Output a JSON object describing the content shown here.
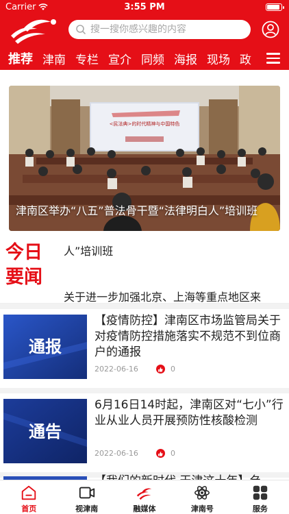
{
  "status_bar": {
    "carrier": "Carrier",
    "time": "3:55 PM"
  },
  "header": {
    "search_placeholder": "搜一搜你感兴趣的内容",
    "tabs": [
      "推荐",
      "津南",
      "专栏",
      "宣介",
      "同频",
      "海报",
      "现场",
      "政"
    ]
  },
  "banner": {
    "caption": "津南区举办“八五”普法骨干暨“法律明白人”培训班",
    "screen_text": "<民法典>的时代精神与中国特色"
  },
  "today": {
    "badge_line1": "今日",
    "badge_line2": "要闻",
    "line1": "人”培训班",
    "line2": "关于进一步加强北京、上海等重点地区来"
  },
  "news": [
    {
      "thumb_text": "通报",
      "title": "【疫情防控】津南区市场监管局关于对疫情防控措施落实不规范不到位商户的通报",
      "date": "2022-06-16",
      "likes": "0"
    },
    {
      "thumb_text": "通告",
      "title": "6月16日14时起，津南区对“七小”行业从业人员开展预防性核酸检测",
      "date": "2022-06-16",
      "likes": "0"
    },
    {
      "thumb_text": "",
      "title": "【我们的新时代 天津这十年】刍",
      "date": "",
      "likes": ""
    }
  ],
  "bottom_nav": [
    {
      "label": "首页",
      "icon": "home-icon"
    },
    {
      "label": "视津南",
      "icon": "video-icon"
    },
    {
      "label": "融媒体",
      "icon": "media-logo-icon"
    },
    {
      "label": "津南号",
      "icon": "atom-icon"
    },
    {
      "label": "服务",
      "icon": "grid-icon"
    }
  ],
  "colors": {
    "brand_red": "#e50f17",
    "thumb_blue": "#1e3f9e"
  }
}
